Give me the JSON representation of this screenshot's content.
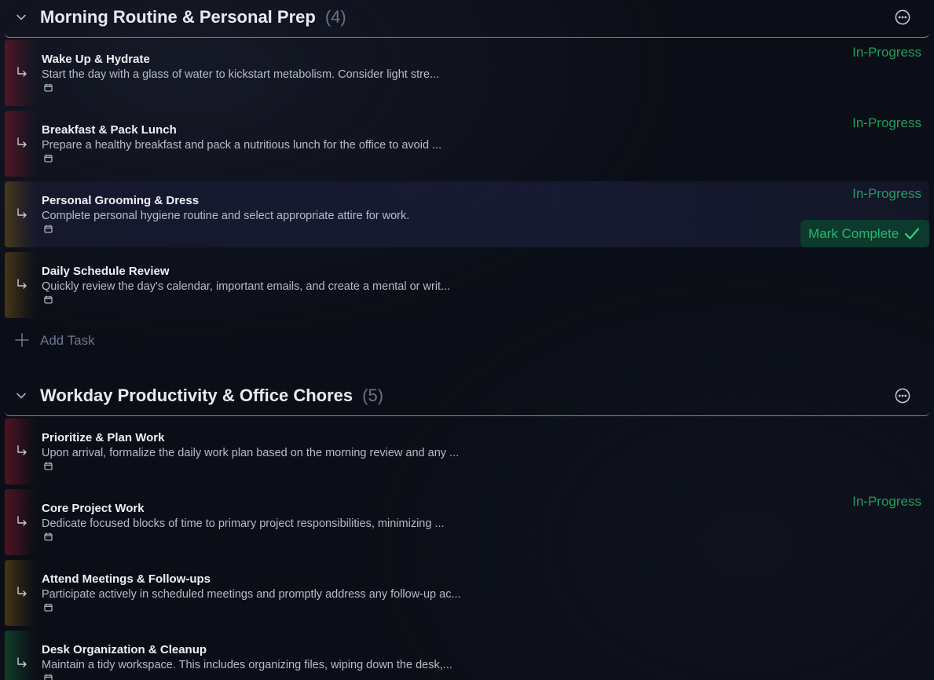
{
  "sections": [
    {
      "title": "Morning Routine & Personal Prep",
      "count": "(4)",
      "tasks": [
        {
          "title": "Wake Up & Hydrate",
          "description": "Start the day with a glass of water to kickstart metabolism. Consider light stre...",
          "status": "In-Progress",
          "accent": "red"
        },
        {
          "title": "Breakfast & Pack Lunch",
          "description": "Prepare a healthy breakfast and pack a nutritious lunch for the office to avoid ...",
          "status": "In-Progress",
          "accent": "red"
        },
        {
          "title": "Personal Grooming & Dress",
          "description": "Complete personal hygiene routine and select appropriate attire for work.",
          "status": "In-Progress",
          "accent": "amber",
          "action_label": "Mark Complete"
        },
        {
          "title": "Daily Schedule Review",
          "description": "Quickly review the day's calendar, important emails, and create a mental or writ...",
          "status": "",
          "accent": "amber"
        }
      ],
      "add_task_label": "Add Task"
    },
    {
      "title": "Workday Productivity & Office Chores",
      "count": "(5)",
      "tasks": [
        {
          "title": "Prioritize & Plan Work",
          "description": "Upon arrival, formalize the daily work plan based on the morning review and any ...",
          "status": "",
          "accent": "red"
        },
        {
          "title": "Core Project Work",
          "description": "Dedicate focused blocks of time to primary project responsibilities, minimizing ...",
          "status": "In-Progress",
          "accent": "red"
        },
        {
          "title": "Attend Meetings & Follow-ups",
          "description": "Participate actively in scheduled meetings and promptly address any follow-up ac...",
          "status": "",
          "accent": "amber"
        },
        {
          "title": "Desk Organization & Cleanup",
          "description": "Maintain a tidy workspace. This includes organizing files, wiping down the desk,...",
          "status": "",
          "accent": "green"
        }
      ]
    }
  ],
  "colors": {
    "background": "#0b0e16",
    "status_green": "#1f9d5e",
    "accent_red": "#6e1628",
    "accent_amber": "#5c4616",
    "accent_green": "#124e2e"
  },
  "icons": {
    "collapse": "chevron-down-icon",
    "more": "more-options-icon",
    "subtask": "subtask-arrow-icon",
    "date": "calendar-icon",
    "add": "plus-icon",
    "complete": "checkmark-icon"
  }
}
